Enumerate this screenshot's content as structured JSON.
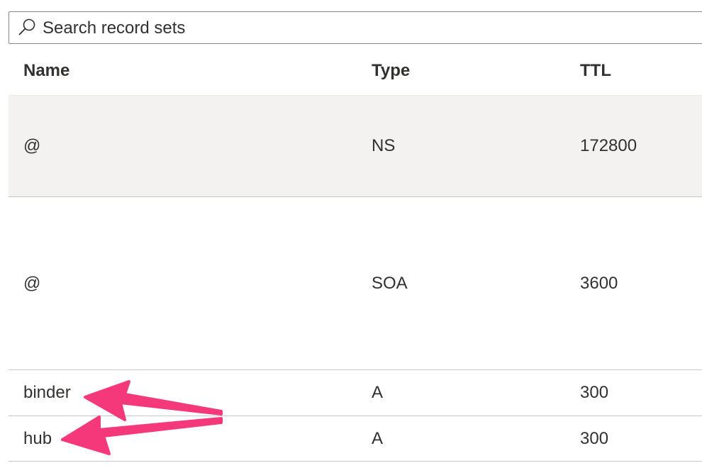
{
  "search": {
    "placeholder": "Search record sets"
  },
  "table": {
    "columns": [
      "Name",
      "Type",
      "TTL"
    ],
    "rows": [
      {
        "name": "@",
        "type": "NS",
        "ttl": "172800",
        "selected": true
      },
      {
        "name": "@",
        "type": "SOA",
        "ttl": "3600",
        "selected": false
      },
      {
        "name": "binder",
        "type": "A",
        "ttl": "300",
        "selected": false
      },
      {
        "name": "hub",
        "type": "A",
        "ttl": "300",
        "selected": false
      }
    ]
  },
  "colors": {
    "arrow": "#f5387a",
    "selected_row_bg": "#f3f2f1",
    "row_border": "#c8c6c4",
    "text": "#323130"
  },
  "annotations": [
    {
      "type": "arrow",
      "points_to": "binder"
    },
    {
      "type": "arrow",
      "points_to": "hub"
    }
  ]
}
